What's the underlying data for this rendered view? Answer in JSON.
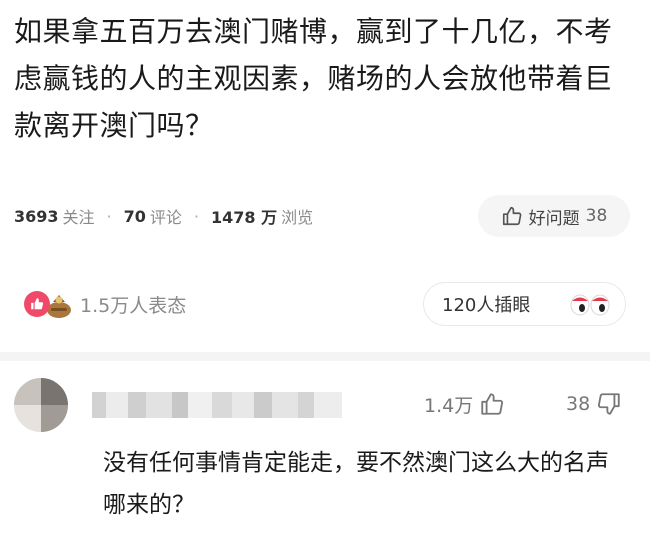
{
  "question": {
    "title": "如果拿五百万去澳门赌博，赢到了十几亿，不考虑赢钱的人的主观因素，赌场的人会放他带着巨款离开澳门吗？"
  },
  "stats": {
    "followers_count": "3693",
    "followers_label": "关注",
    "separator": "·",
    "comments_count": "70",
    "comments_label": "评论",
    "views_count": "1478 万",
    "views_label": "浏览"
  },
  "good_question": {
    "icon": "thumbs-up-icon",
    "label": "好问题",
    "count": "38"
  },
  "reactions": {
    "icons": [
      "like-icon",
      "money-bag-emoji-icon"
    ],
    "summary": "1.5万人表态",
    "accent": "#f04a6b"
  },
  "cha_yan": {
    "label": "120人插眼",
    "icon": "eyes-emoji-icon"
  },
  "comment": {
    "avatar": "blurred-avatar",
    "username": "",
    "likes": "1.4万",
    "dislikes": "38",
    "text": "没有任何事情肯定能走，要不然澳门这么大的名声哪来的？"
  }
}
